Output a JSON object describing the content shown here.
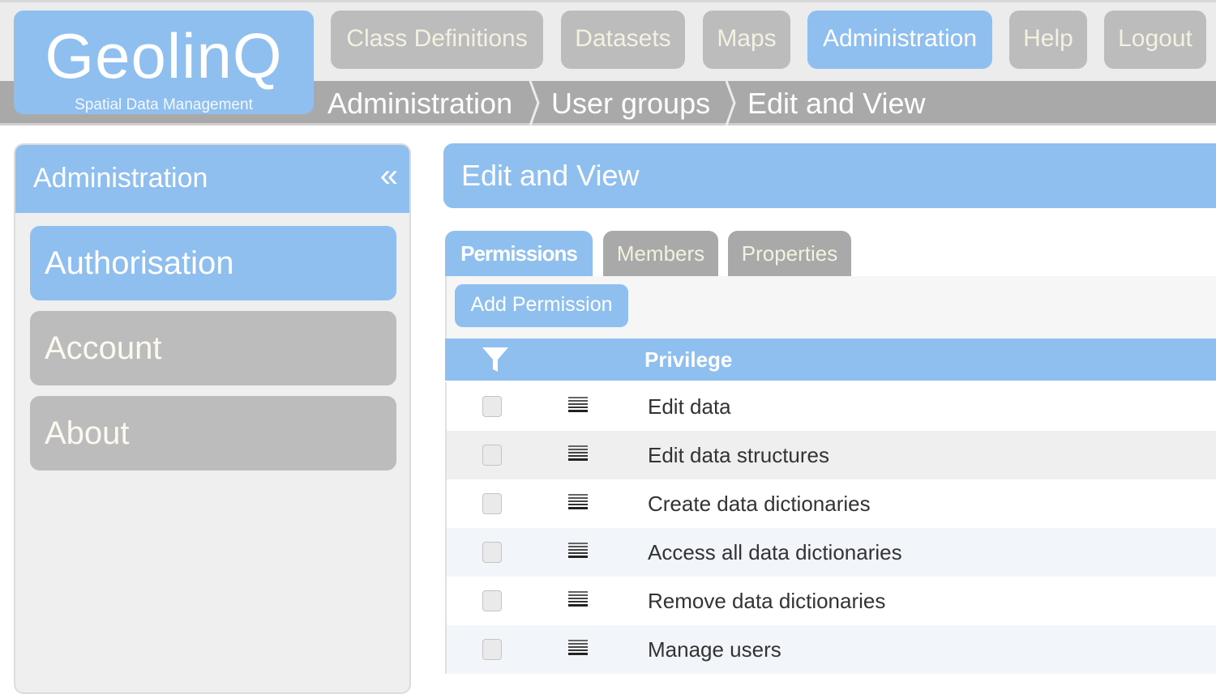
{
  "app": {
    "logo_name": "GeolinQ",
    "logo_tagline": "Spatial Data Management"
  },
  "nav": {
    "items": [
      {
        "label": "Class Definitions",
        "active": false
      },
      {
        "label": "Datasets",
        "active": false
      },
      {
        "label": "Maps",
        "active": false
      },
      {
        "label": "Administration",
        "active": true
      },
      {
        "label": "Help",
        "active": false
      },
      {
        "label": "Logout",
        "active": false
      }
    ]
  },
  "breadcrumb": [
    "Administration",
    "User groups",
    "Edit and View"
  ],
  "sidebar": {
    "title": "Administration",
    "collapse_icon": "double-chevron-left-icon",
    "items": [
      {
        "label": "Authorisation",
        "active": true
      },
      {
        "label": "Account",
        "active": false
      },
      {
        "label": "About",
        "active": false
      }
    ]
  },
  "panel": {
    "title": "Edit and View",
    "tabs": [
      {
        "label": "Permissions",
        "active": true
      },
      {
        "label": "Members",
        "active": false
      },
      {
        "label": "Properties",
        "active": false
      }
    ],
    "add_button": "Add Permission",
    "grid": {
      "filter_icon": "filter-icon",
      "column_header": "Privilege",
      "rows": [
        {
          "checked": false,
          "label": "Edit data"
        },
        {
          "checked": false,
          "label": "Edit data structures"
        },
        {
          "checked": false,
          "label": "Create data dictionaries"
        },
        {
          "checked": false,
          "label": "Access all data dictionaries"
        },
        {
          "checked": false,
          "label": "Remove data dictionaries"
        },
        {
          "checked": false,
          "label": "Manage users"
        }
      ]
    }
  },
  "colors": {
    "accent": "#8fbfef",
    "inactive": "#bcbcbc",
    "breadcrumb_bar": "#a9a9a9"
  }
}
